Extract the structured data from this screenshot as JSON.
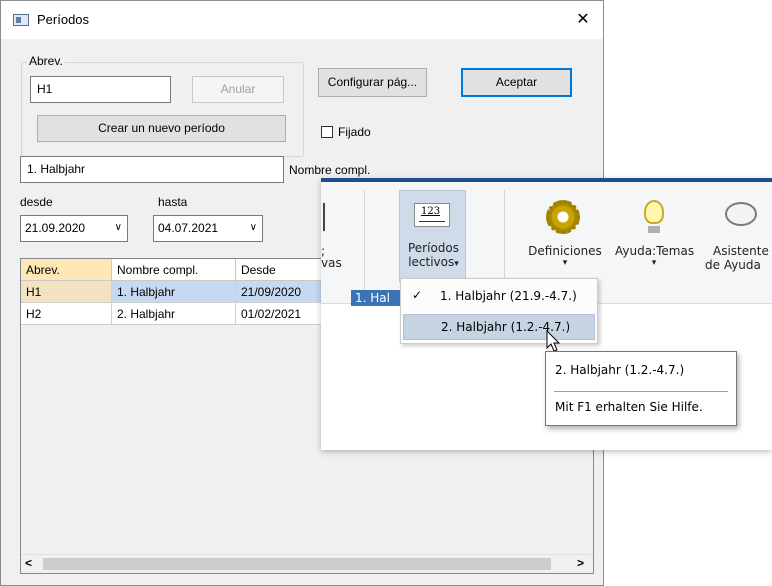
{
  "dialog": {
    "title": "Períodos",
    "close_glyph": "✕",
    "group_label": "Abrev.",
    "abbrev_value": "H1",
    "cancel_label": "Anular",
    "create_label": "Crear un nuevo período",
    "page_setup_label": "Configurar pág...",
    "accept_label": "Aceptar",
    "fixed_label": "Fijado",
    "fullname_value": "1. Halbjahr",
    "fullname_label": "Nombre compl.",
    "from_label": "desde",
    "to_label": "hasta",
    "from_value": "21.09.2020",
    "to_value": "04.07.2021"
  },
  "table": {
    "headers": [
      "Abrev.",
      "Nombre compl.",
      "Desde"
    ],
    "rows": [
      [
        "H1",
        "1. Halbjahr",
        "21/09/2020"
      ],
      [
        "H2",
        "2. Halbjahr",
        "01/02/2021"
      ]
    ],
    "scroll_left": "<",
    "scroll_right": ">"
  },
  "ribbon": {
    "partial_label_1": ";",
    "partial_label_2": "vas",
    "periods_line1": "Períodos",
    "periods_line2": "lectivos",
    "periods_icon_text": "123",
    "definitions_label": "Definiciones",
    "help_topics_label": "Ayuda:Temas",
    "assistant_line1": "Asistente",
    "assistant_line2": "de Ayuda",
    "dropdown_arrow": "▾",
    "selected_period_partial": "1. Hal",
    "accent_color": "#1e4f8d"
  },
  "period_menu": {
    "items": [
      {
        "label": "1. Halbjahr (21.9.-4.7.)",
        "checked": true
      },
      {
        "label": "2. Halbjahr (1.2.-4.7.)",
        "checked": false
      }
    ],
    "check_glyph": "✓"
  },
  "tooltip": {
    "title": "2. Halbjahr (1.2.-4.7.)",
    "hint": "Mit F1 erhalten Sie Hilfe."
  }
}
